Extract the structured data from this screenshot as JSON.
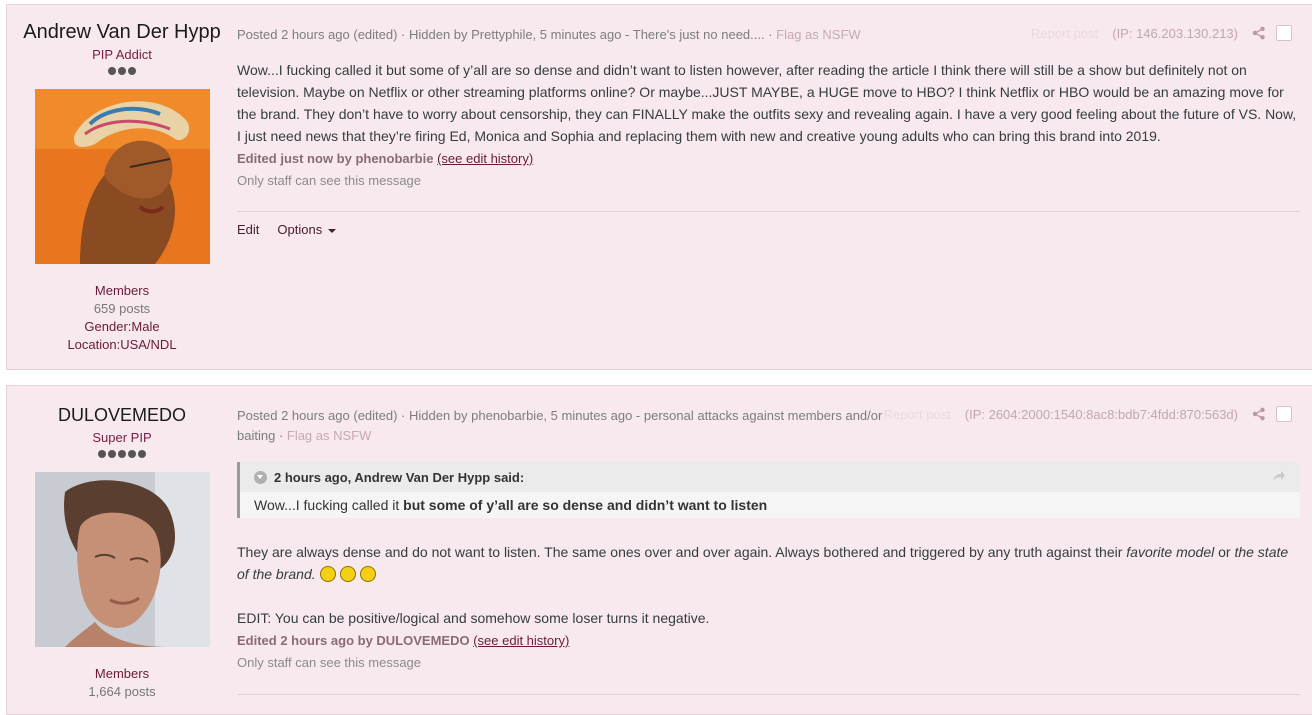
{
  "posts": [
    {
      "author": {
        "name": "Andrew Van Der Hypp",
        "rank": "PIP Addict",
        "group": "Members",
        "posts": "659 posts",
        "gender": "Gender:Male",
        "location": "Location:USA/NDL"
      },
      "header": {
        "posted": "Posted 2 hours ago (edited) · Hidden by Prettyphile, 5 minutes ago - There's just no need.... · ",
        "flag": "Flag as NSFW",
        "report": "Report post",
        "ip": "(IP: 146.203.130.213)"
      },
      "body": "Wow...I fucking called it but some of y’all are so dense and didn’t want to listen  however, after reading the article I think there will still be a show but definitely not on television. Maybe on Netflix or other streaming platforms online? Or maybe...JUST MAYBE, a HUGE move to HBO? I think Netflix or HBO would be an amazing move for the brand. They don’t have to worry about censorship, they can FINALLY make the outfits sexy and revealing again. I have a very good feeling about the future of VS. Now, I just need news that they’re firing Ed, Monica and Sophia and replacing them with new and creative young adults who can bring this brand into 2019.",
      "edited": "Edited just now by phenobarbie",
      "edit_history": "(see edit history)",
      "staff_note": "Only staff can see this message",
      "controls": {
        "edit": "Edit",
        "options": "Options"
      }
    },
    {
      "author": {
        "name": "DULOVEMEDO",
        "rank": "Super PIP",
        "group": "Members",
        "posts": "1,664 posts"
      },
      "header": {
        "posted": "Posted 2 hours ago (edited) · Hidden by phenobarbie, 5 minutes ago - personal attacks against members and/or baiting · ",
        "flag": "Flag as NSFW",
        "report": "Report post",
        "ip": "(IP: 2604:2000:1540:8ac8:bdb7:4fdd:870:563d)"
      },
      "quote": {
        "citation": "2 hours ago, Andrew Van Der Hypp said:",
        "text_plain": "Wow...I fucking called it ",
        "text_bold": "but some of y’all are so dense and didn’t want to listen"
      },
      "body_part1": "They are always dense and do not want to listen. The same ones over and over again. Always bothered and triggered by any truth against their ",
      "body_em1": "favorite model",
      "body_mid": " or ",
      "body_em2": "the state of the brand.",
      "body_edit": "EDIT: You can be positive/logical and somehow some loser turns it negative.",
      "edited": "Edited 2 hours ago by DULOVEMEDO",
      "edit_history": "(see edit history)",
      "staff_note": "Only staff can see this message"
    }
  ]
}
